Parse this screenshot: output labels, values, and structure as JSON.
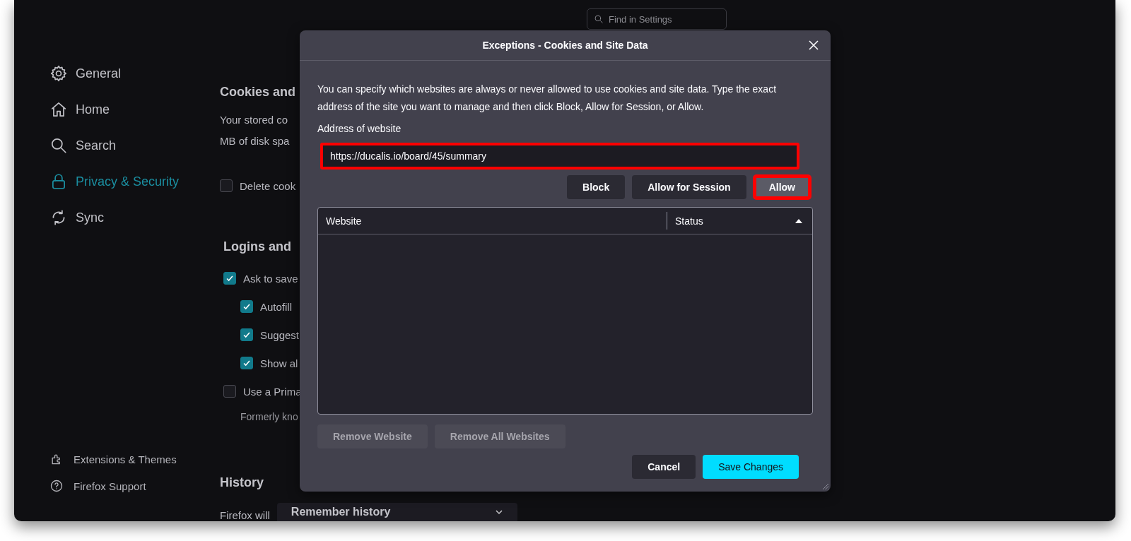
{
  "sidebar": {
    "items": [
      {
        "kind": "gear",
        "label": "General",
        "selected": false
      },
      {
        "kind": "home",
        "label": "Home",
        "selected": false
      },
      {
        "kind": "search",
        "label": "Search",
        "selected": false
      },
      {
        "kind": "lock",
        "label": "Privacy & Security",
        "selected": true
      },
      {
        "kind": "sync",
        "label": "Sync",
        "selected": false
      }
    ],
    "footer_links": [
      {
        "kind": "puzzle",
        "label": "Extensions & Themes"
      },
      {
        "kind": "help",
        "label": "Firefox Support"
      }
    ]
  },
  "search": {
    "placeholder": "Find in Settings"
  },
  "sections": [
    {
      "heading": "Cookies and",
      "items": [
        {
          "kind": "text",
          "text": "Your stored co"
        },
        {
          "kind": "text",
          "text": "MB of disk spa"
        },
        {
          "kind": "checkbox",
          "label": "Delete cook",
          "checked": false
        }
      ]
    },
    {
      "heading": "Logins and",
      "items": [
        {
          "kind": "checkbox",
          "label": "Ask to save",
          "checked": true,
          "children": [
            {
              "kind": "checkbox",
              "label": "Autofill",
              "checked": true
            },
            {
              "kind": "checkbox",
              "label": "Suggest",
              "checked": true
            },
            {
              "kind": "checkbox",
              "label": "Show al",
              "checked": true
            }
          ]
        },
        {
          "kind": "checkbox",
          "label": "Use a Prima",
          "checked": false,
          "children": [
            {
              "kind": "note",
              "text": "Formerly kno"
            }
          ]
        }
      ]
    },
    {
      "heading": "History",
      "items": [
        {
          "kind": "select",
          "label": "Firefox will",
          "value": "Remember history"
        }
      ]
    }
  ],
  "dialog": {
    "title": "Exceptions - Cookies and Site Data",
    "description": "You can specify which websites are always or never allowed to use cookies and site data. Type the exact address of the site you want to manage and then click Block, Allow for Session, or Allow.",
    "address_label": "Address of website",
    "address": {
      "value": "https://ducalis.io/board/45/summary",
      "highlighted": true
    },
    "actions": [
      {
        "label": "Block",
        "highlighted": false,
        "hovered": false
      },
      {
        "label": "Allow for Session",
        "highlighted": false,
        "hovered": false
      },
      {
        "label": "Allow",
        "highlighted": true,
        "hovered": true
      }
    ],
    "table": {
      "columns": [
        {
          "label": "Website",
          "sorted": false
        },
        {
          "label": "Status",
          "sorted": true
        }
      ]
    },
    "list_buttons": [
      {
        "label": "Remove Website",
        "disabled": true
      },
      {
        "label": "Remove All Websites",
        "disabled": true
      }
    ],
    "footer_buttons": [
      {
        "label": "Cancel",
        "kind": "secondary"
      },
      {
        "label": "Save Changes",
        "kind": "primary"
      }
    ]
  }
}
